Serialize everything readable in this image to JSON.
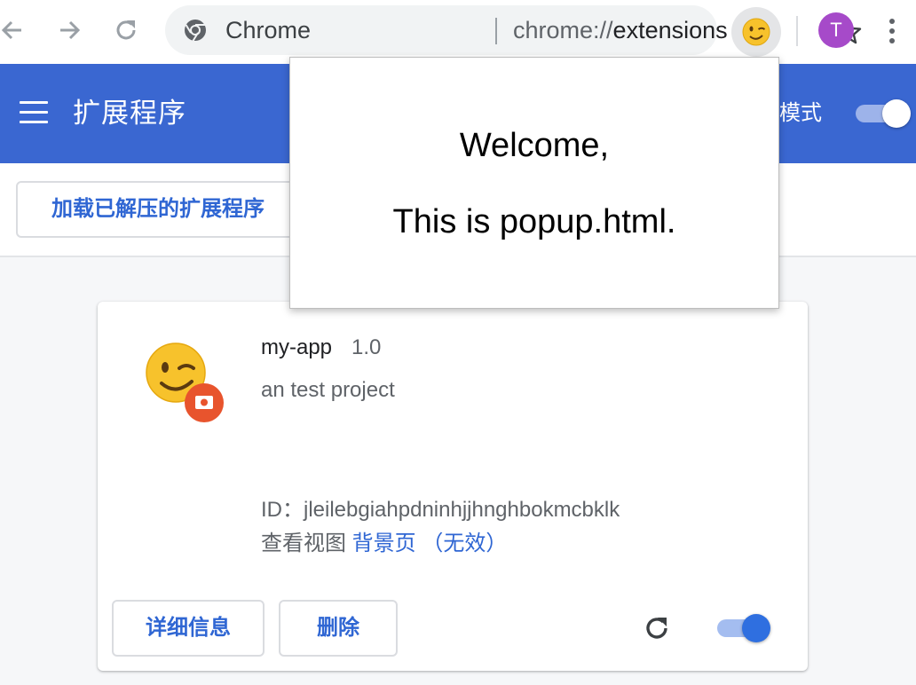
{
  "browser": {
    "omnibox": {
      "site_chip": "Chrome",
      "url_scheme": "chrome://",
      "url_path": "extensions"
    },
    "profile_initial": "T",
    "icons": {
      "back": "arrow-left-icon",
      "forward": "arrow-right-icon",
      "reload": "reload-icon",
      "site": "chrome-logo-icon",
      "bookmark": "star-icon",
      "extension": "winking-face-icon",
      "menu": "three-dots-icon"
    },
    "colors": {
      "avatar": "#a64ac9",
      "omnibox_bg": "#f1f3f4"
    }
  },
  "header": {
    "title": "扩展程序",
    "dev_mode_label": "模式",
    "dev_mode_on": true,
    "background": "#3a67d1"
  },
  "toolbar": {
    "load_unpacked_label": "加载已解压的扩展程序"
  },
  "extension": {
    "name": "my-app",
    "version": "1.0",
    "description": "an test project",
    "id_label": "ID：",
    "id_value": "jleilebgiahpdninhjjhnghbokmcbklk",
    "views_label": "查看视图",
    "views_link": "背景页 （无效）",
    "details_label": "详细信息",
    "remove_label": "删除",
    "enabled": true,
    "accent": "#2f66d3"
  },
  "popup": {
    "line1": "Welcome,",
    "line2": "This is popup.html."
  }
}
